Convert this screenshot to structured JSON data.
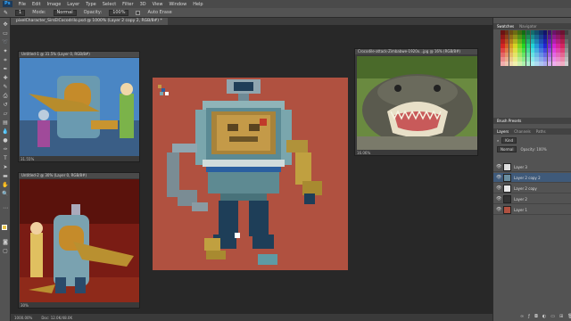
{
  "app": {
    "logo": "Ps"
  },
  "menu": [
    "File",
    "Edit",
    "Image",
    "Layer",
    "Type",
    "Select",
    "Filter",
    "3D",
    "View",
    "Window",
    "Help"
  ],
  "options": {
    "mode_label": "Mode:",
    "mode_value": "Normal",
    "opacity_label": "Opacity:",
    "opacity_value": "100%",
    "auto_erase": "Auto Erase"
  },
  "tab": {
    "title": "pixelCharacter_SirsElCocodrilo.psd @ 1000% (Layer 2 copy 2, RGB/8#) *"
  },
  "doc1": {
    "title": "Untitled-1 @ 31.5% (Layer 0, RGB/8#)",
    "zoom": "31.55%"
  },
  "doc2": {
    "title": "Untitled-2 @ 30% (Layer 0, RGB/8#)",
    "zoom": "30%"
  },
  "doc3": {
    "title": "Crocodile-attack-Zimbabwe-1920x…jpg @ 16% (RGB/8#)",
    "zoom": "16.06%"
  },
  "status": {
    "zoom": "1000.00%",
    "doc": "Doc: 12.0K/48.0K"
  },
  "panels": {
    "swatches_tabs": [
      "Swatches",
      "Navigator"
    ],
    "brush_presets": "Brush Presets",
    "layers_tabs": [
      "Layers",
      "Channels",
      "Paths"
    ],
    "kind_label": "Kind",
    "blend_mode": "Normal",
    "opacity_short": "Opacity: 100%",
    "layers": [
      {
        "name": "Layer 3",
        "selected": false
      },
      {
        "name": "Layer 2 copy 2",
        "selected": true
      },
      {
        "name": "Layer 2 copy",
        "selected": false
      },
      {
        "name": "Layer 2",
        "selected": false
      },
      {
        "name": "Layer 1",
        "selected": false
      }
    ]
  }
}
